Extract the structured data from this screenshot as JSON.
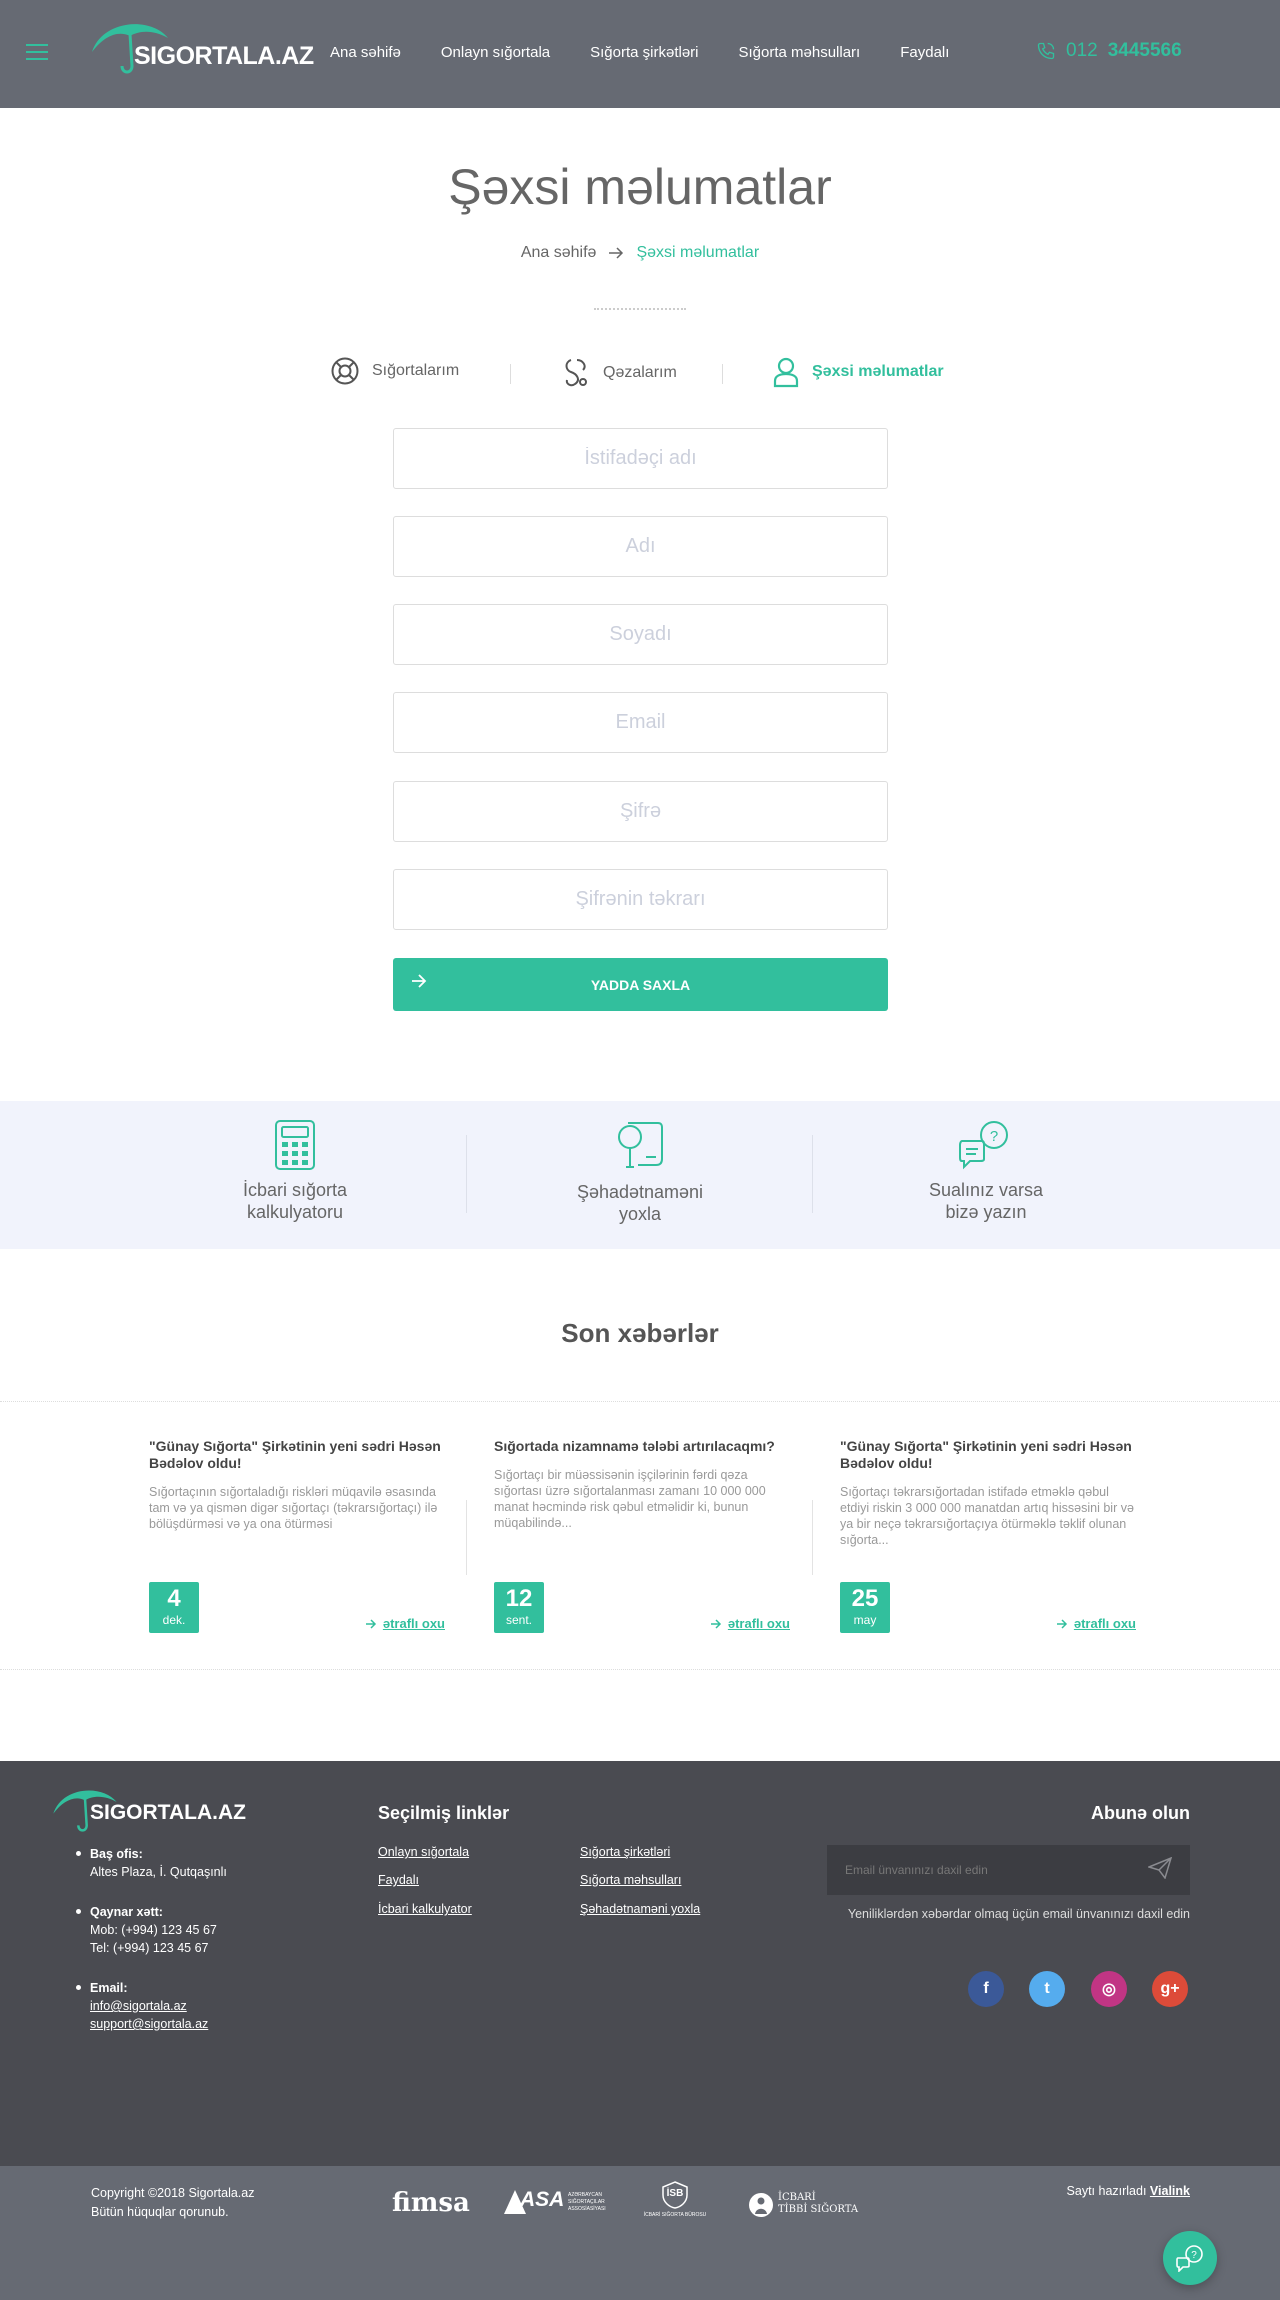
{
  "colors": {
    "accent": "#32bf9d",
    "header_bg": "#666a73",
    "footer_bg": "#4a4b51",
    "features_bg": "#f1f3fc"
  },
  "header": {
    "logo_text": "SIGORTALA.AZ",
    "nav": [
      "Ana səhifə",
      "Onlayn sığortala",
      "Sığorta şirkətləri",
      "Sığorta məhsulları",
      "Faydalı"
    ],
    "phone_prefix": "012",
    "phone_number": "3445566",
    "icons": {
      "menu": "hamburger-icon",
      "phone": "phone-icon"
    }
  },
  "hero": {
    "title": "Şəxsi məlumatlar",
    "breadcrumb_home": "Ana səhifə",
    "breadcrumb_current": "Şəxsi məlumatlar"
  },
  "tabs": [
    {
      "label": "Sığortalarım",
      "icon": "lifebuoy-icon",
      "active": false
    },
    {
      "label": "Qəzalarım",
      "icon": "accident-icon",
      "active": false
    },
    {
      "label": "Şəxsi məlumatlar",
      "icon": "user-icon",
      "active": true
    }
  ],
  "form": {
    "username_placeholder": "İstifadəçi adı",
    "name_placeholder": "Adı",
    "surname_placeholder": "Soyadı",
    "email_placeholder": "Email",
    "password_placeholder": "Şifrə",
    "password_repeat_placeholder": "Şifrənin təkrarı",
    "username_value": "",
    "name_value": "",
    "surname_value": "",
    "email_value": "",
    "password_value": "",
    "password_repeat_value": "",
    "save_label": "YADDA SAXLA"
  },
  "features": [
    {
      "line1": "İcbari sığorta",
      "line2": "kalkulyatoru",
      "icon": "calculator-icon"
    },
    {
      "line1": "Şəhadətnaməni",
      "line2": "yoxla",
      "icon": "certificate-search-icon"
    },
    {
      "line1": "Sualınız varsa",
      "line2": "bizə yazın",
      "icon": "chat-question-icon"
    }
  ],
  "news": {
    "title": "Son xəbərlər",
    "more_label": "ətraflı oxu",
    "items": [
      {
        "title": "\"Günay Sığorta\" Şirkətinin yeni sədri Həsən Bədəlov oldu!",
        "text": "Sığortaçının sığortaladığı riskləri müqavilə əsasında tam və ya qismən digər sığortaçı (təkrarsığortaçı) ilə bölüşdürməsi və ya ona ötürməsi",
        "day": "4",
        "month": "dek."
      },
      {
        "title": "Sığortada nizamnamə tələbi artırılacaqmı?",
        "text": "Sığortaçı bir müəssisənin işçilərinin fərdi qəza sığortası üzrə sığortalanması zamanı 10 000 000 manat həcmində risk qəbul etməlidir ki, bunun müqabilində...",
        "day": "12",
        "month": "sent."
      },
      {
        "title": "\"Günay Sığorta\" Şirkətinin yeni sədri Həsən Bədəlov oldu!",
        "text": "Sığortaçı təkrarsığortadan istifadə etməklə qəbul etdiyi riskin 3 000 000 manatdan artıq hissəsini bir və ya bir neçə təkrarsığortaçıya ötürməklə təklif olunan sığorta...",
        "day": "25",
        "month": "may"
      }
    ]
  },
  "footer": {
    "logo_text": "SIGORTALA.AZ",
    "office_label": "Baş ofis:",
    "office_value": "Altes Plaza, İ. Qutqaşınlı",
    "hotline_label": "Qaynar xətt:",
    "mob_prefix": "Mob:",
    "mob_value": "(+994) 123 45 67",
    "tel_prefix": "Tel:",
    "tel_value": "(+994) 123 45 67",
    "email_label": "Email:",
    "email_1": "info@sigortala.az",
    "email_2": "support@sigortala.az",
    "links_title": "Seçilmiş linklər",
    "links": [
      "Onlayn sığortala",
      "Sığorta şirkətləri",
      "Faydalı",
      "Sığorta məhsulları",
      "İcbari kalkulyator",
      "Şəhadətnaməni yoxla"
    ],
    "subscribe_title": "Abunə olun",
    "subscribe_placeholder": "Email ünvanınızı daxil edin",
    "subscribe_value": "",
    "subscribe_note": "Yeniliklərdən xəbərdar olmaq üçün email ünvanınızı daxil edin",
    "social": [
      {
        "icon": "facebook-icon",
        "glyph": "f",
        "color": "#3b5998"
      },
      {
        "icon": "twitter-icon",
        "glyph": "t",
        "color": "#55acee"
      },
      {
        "icon": "instagram-icon",
        "glyph": "◎",
        "color": "#c13584"
      },
      {
        "icon": "google-plus-icon",
        "glyph": "g+",
        "color": "#dd4b39"
      }
    ]
  },
  "bottom": {
    "copyright_1": "Copyright ©2018 Sigortala.az",
    "copyright_2": "Bütün hüquqlar qorunub.",
    "made_by_prefix": "Saytı hazırladı",
    "made_by_link": "Vialink",
    "partners": {
      "fimsa": "fimsa",
      "asa": "ASA",
      "asa_sub": "AZƏRBAYCAN SIĞORTAÇILAR ASSOSİASİYASI",
      "isb": "İSB",
      "isb_sub": "İCBARİ SIĞORTA BÜROSU",
      "its_1": "İCBARİ",
      "its_2": "TİBBİ SIĞORTA"
    }
  }
}
